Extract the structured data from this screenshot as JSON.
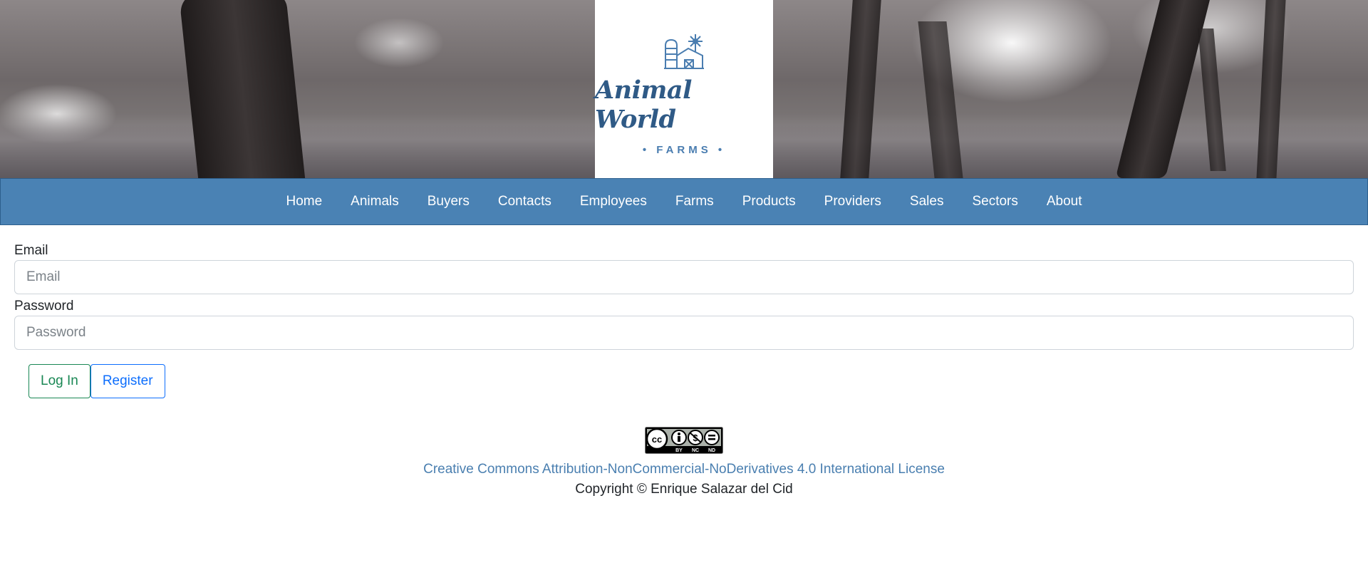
{
  "header": {
    "logo_title": "Animal World",
    "logo_subtitle": "• FARMS •"
  },
  "nav": {
    "items": [
      {
        "label": "Home"
      },
      {
        "label": "Animals"
      },
      {
        "label": "Buyers"
      },
      {
        "label": "Contacts"
      },
      {
        "label": "Employees"
      },
      {
        "label": "Farms"
      },
      {
        "label": "Products"
      },
      {
        "label": "Providers"
      },
      {
        "label": "Sales"
      },
      {
        "label": "Sectors"
      },
      {
        "label": "About"
      }
    ]
  },
  "form": {
    "email_label": "Email",
    "email_placeholder": "Email",
    "email_value": "",
    "password_label": "Password",
    "password_placeholder": "Password",
    "password_value": "",
    "login_label": "Log In",
    "register_label": "Register"
  },
  "footer": {
    "license_link": "Creative Commons Attribution-NonCommercial-NoDerivatives 4.0 International License",
    "copyright": "Copyright © Enrique Salazar del Cid",
    "badge_text": [
      "BY",
      "NC",
      "ND"
    ]
  },
  "colors": {
    "nav_bg": "#4a82b4",
    "logo_text": "#2f5a86",
    "login_border": "#198754",
    "register_border": "#0d6efd",
    "link": "#4a7fb0"
  }
}
